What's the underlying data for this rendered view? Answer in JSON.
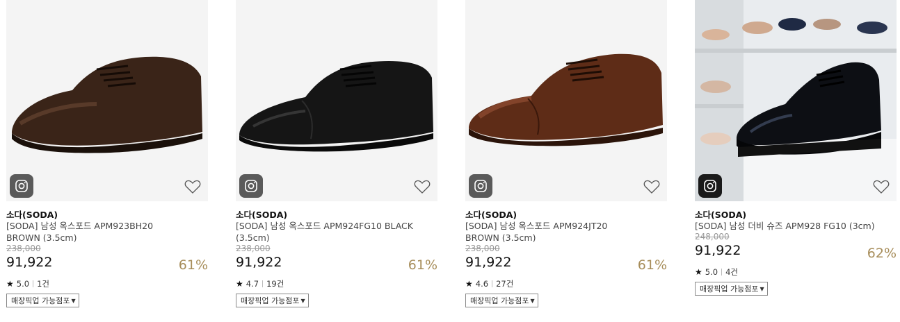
{
  "products": [
    {
      "brand": "소다(SODA)",
      "name_line1": "[SODA] 남성 옥스포드 APM923BH20",
      "name_line2": "BROWN (3.5cm)",
      "original_price": "238,000",
      "sale_price": "91,922",
      "discount": "61%",
      "rating": "5.0",
      "reviews": "1건",
      "pickup_label": "매장픽업 가능점포",
      "shoe_color": "#3a2418",
      "bg_color": "#f4f4f4"
    },
    {
      "brand": "소다(SODA)",
      "name_line1": "[SODA] 남성 옥스포드 APM924FG10 BLACK",
      "name_line2": "(3.5cm)",
      "original_price": "238,000",
      "sale_price": "91,922",
      "discount": "61%",
      "rating": "4.7",
      "reviews": "19건",
      "pickup_label": "매장픽업 가능점포",
      "shoe_color": "#151515",
      "bg_color": "#f4f4f4"
    },
    {
      "brand": "소다(SODA)",
      "name_line1": "[SODA] 남성 옥스포드 APM924JT20",
      "name_line2": "BROWN (3.5cm)",
      "original_price": "238,000",
      "sale_price": "91,922",
      "discount": "61%",
      "rating": "4.6",
      "reviews": "27건",
      "pickup_label": "매장픽업 가능점포",
      "shoe_color": "#5e2c17",
      "bg_color": "#f4f4f4"
    },
    {
      "brand": "소다(SODA)",
      "name_line1": "[SODA] 남성 더비 슈즈 APM928 FG10 (3cm)",
      "original_price": "248,000",
      "sale_price": "91,922",
      "discount": "62%",
      "rating": "5.0",
      "reviews": "4건",
      "pickup_label": "매장픽업 가능점포",
      "shoe_color": "#0d0f14",
      "bg_color": "#e9ecef"
    }
  ],
  "icons": {
    "instagram": "instagram-icon",
    "wishlist": "heart-icon",
    "star": "★",
    "dropdown": "▼"
  }
}
